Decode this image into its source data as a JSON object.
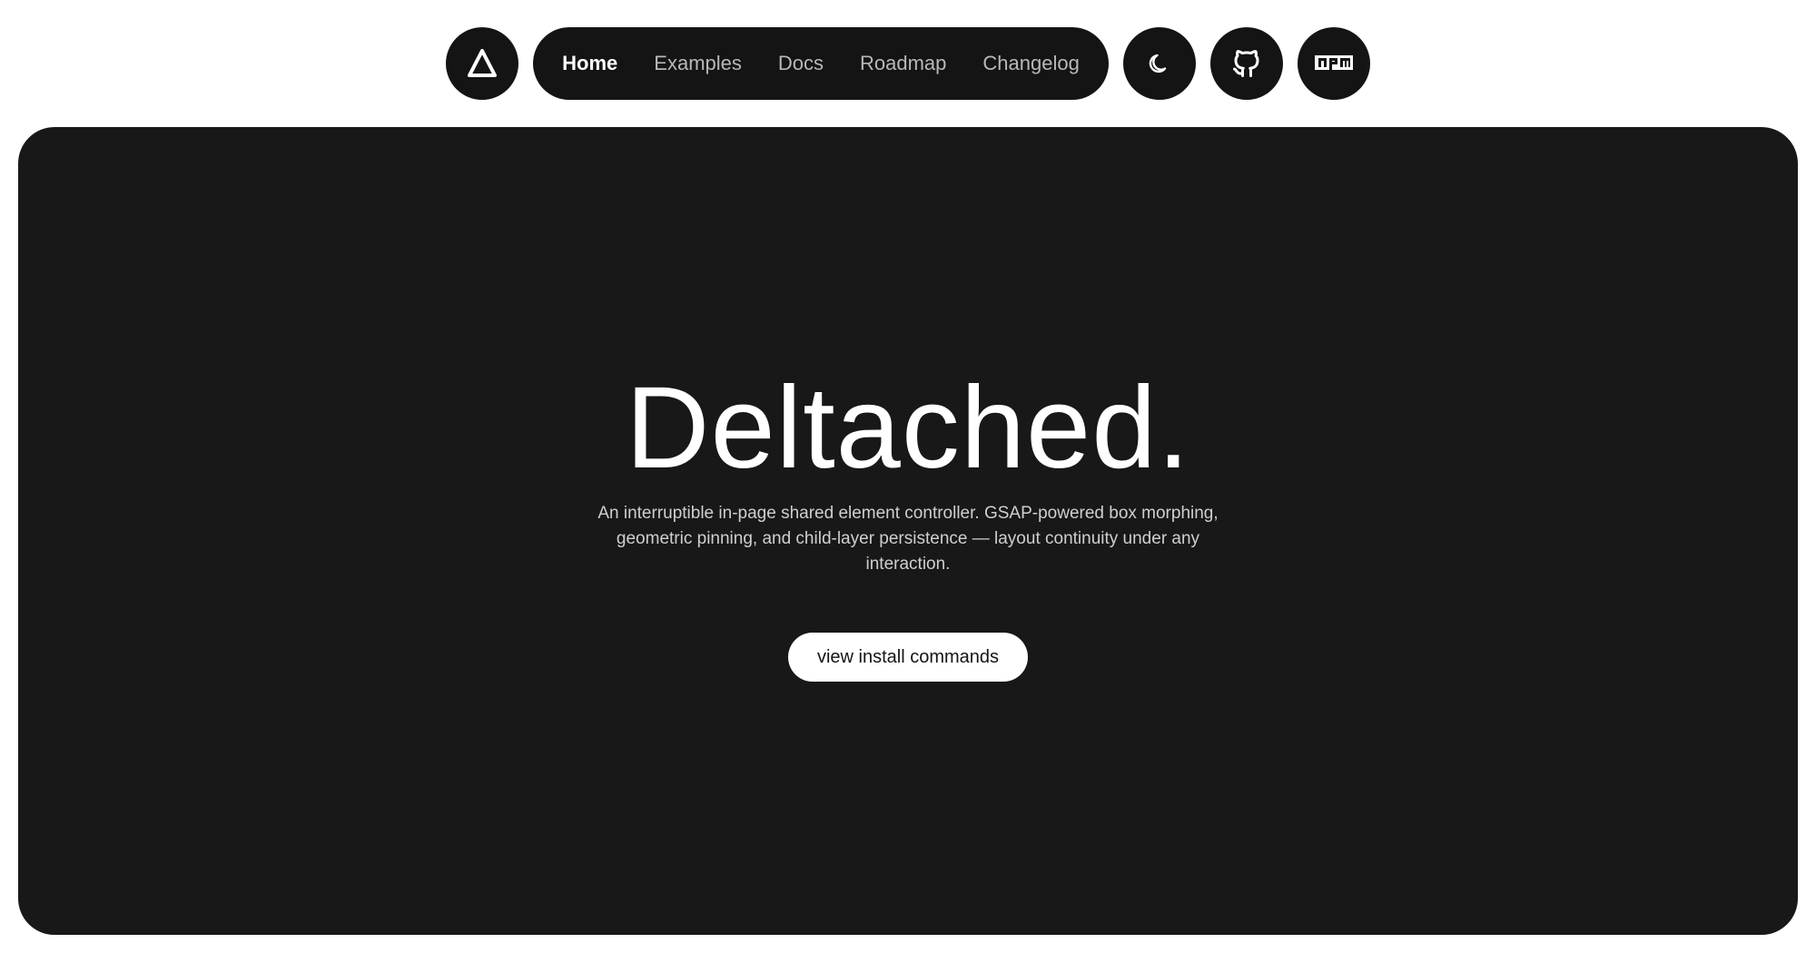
{
  "nav": {
    "logo_icon": "delta-triangle-icon",
    "items": [
      {
        "label": "Home",
        "active": true
      },
      {
        "label": "Examples",
        "active": false
      },
      {
        "label": "Docs",
        "active": false
      },
      {
        "label": "Roadmap",
        "active": false
      },
      {
        "label": "Changelog",
        "active": false
      }
    ],
    "theme_icon": "moon-icon",
    "github_icon": "github-icon",
    "npm_icon": "npm-icon"
  },
  "hero": {
    "title": "Deltached.",
    "description": "An interruptible in-page shared element controller. GSAP-powered box morphing, geometric pinning, and child-layer persistence — layout continuity under any interaction.",
    "cta_label": "view install commands"
  },
  "colors": {
    "page_background": "#ffffff",
    "nav_background": "#141414",
    "hero_background": "#181818",
    "nav_text": "#b8b8b8",
    "nav_text_active": "#ffffff",
    "cta_background": "#ffffff",
    "cta_text": "#141414"
  }
}
